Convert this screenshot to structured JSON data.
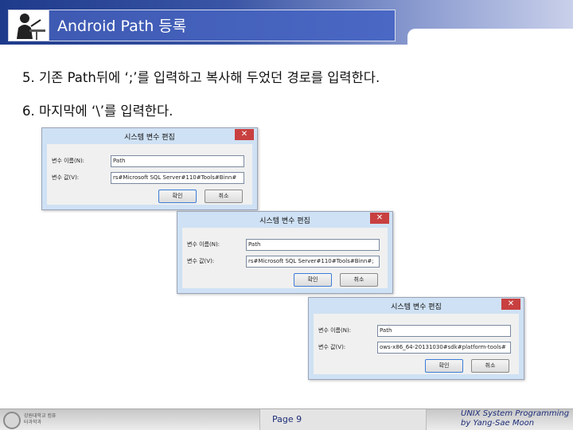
{
  "header": {
    "title": "Android Path 등록"
  },
  "steps": [
    "5. 기존 Path뒤에 ‘;’를 입력하고 복사해 두었던 경로를 입력한다.",
    "6. 마지막에 ‘\\’를 입력한다."
  ],
  "dialogs": [
    {
      "title": "시스템 변수 편집",
      "close": "✕",
      "name_label": "변수 이름(N):",
      "value_label": "변수 값(V):",
      "name_value": "Path",
      "value_value": "rs#Microsoft SQL Server#110#Tools#Binn#",
      "ok": "확인",
      "cancel": "취소"
    },
    {
      "title": "시스템 변수 편집",
      "close": "✕",
      "name_label": "변수 이름(N):",
      "value_label": "변수 값(V):",
      "name_value": "Path",
      "value_value": "rs#Microsoft SQL Server#110#Tools#Binn#;",
      "ok": "확인",
      "cancel": "취소"
    },
    {
      "title": "시스템 변수 편집",
      "close": "✕",
      "name_label": "변수 이름(N):",
      "value_label": "변수 값(V):",
      "name_value": "Path",
      "value_value": "ows-x86_64-20131030#sdk#platform-tools#",
      "ok": "확인",
      "cancel": "취소"
    }
  ],
  "footer": {
    "univ": "강원대학교 컴퓨터과학과",
    "page": "Page 9",
    "credit_line1": "UNIX System Programming",
    "credit_line2": "by Yang-Sae Moon"
  },
  "icons": {
    "presenter": "presenter-icon",
    "university_seal": "university-seal-icon"
  }
}
